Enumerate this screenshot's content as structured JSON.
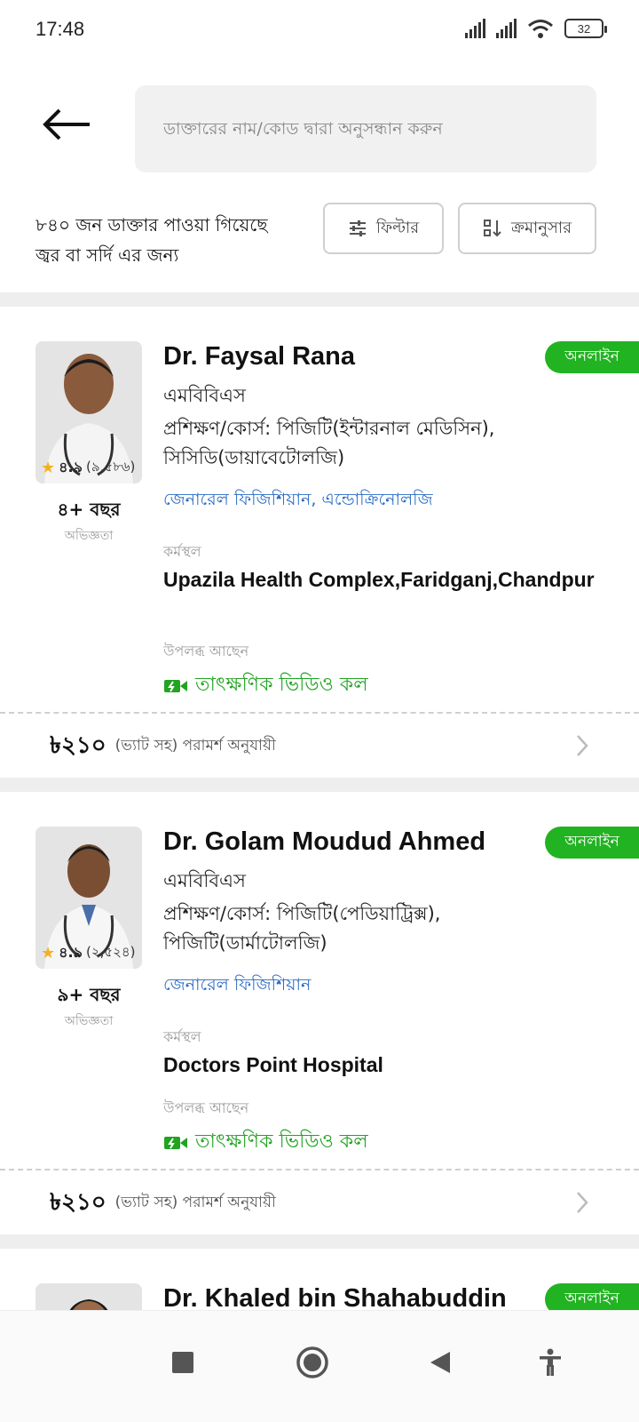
{
  "status": {
    "time": "17:48",
    "battery": "32"
  },
  "search": {
    "placeholder": "ডাক্তারের নাম/কোড দ্বারা অনুসন্ধান করুন"
  },
  "results": {
    "line1": "৮৪০ জন ডাক্তার পাওয়া গিয়েছে",
    "line2": "জ্বর বা সর্দি এর জন্য"
  },
  "toolbar": {
    "filter_label": "ফিল্টার",
    "sort_label": "ক্রমানুসার"
  },
  "doctors": [
    {
      "name": "Dr. Faysal Rana",
      "status": "অনলাইন",
      "degree": "এমবিবিএস",
      "training": "প্রশিক্ষণ/কোর্স: পিজিটি(ইন্টারনাল মেডিসিন), সিসিডি(ডায়াবেটোলজি)",
      "specialty": "জেনারেল ফিজিশিয়ান,  এন্ডোক্রিনোলজি",
      "workplace_label": "কর্মস্থল",
      "workplace": "Upazila Health Complex,Faridganj,Chandpur",
      "availability_label": "উপলব্ধ আছেন",
      "availability": "তাৎক্ষণিক ভিডিও কল",
      "rating": "৪.৯",
      "rating_count": "(৯,৫৮৬)",
      "experience": "৪+ বছর",
      "experience_label": "অভিজ্ঞতা",
      "fee": "৳২১০",
      "fee_note": "(ভ্যাট সহ) পরামর্শ অনুযায়ী"
    },
    {
      "name": "Dr. Golam Moudud Ahmed",
      "status": "অনলাইন",
      "degree": "এমবিবিএস",
      "training": "প্রশিক্ষণ/কোর্স: পিজিটি(পেডিয়াট্রিক্স), পিজিটি(ডার্মাটোলজি)",
      "specialty": "জেনারেল ফিজিশিয়ান",
      "workplace_label": "কর্মস্থল",
      "workplace": "Doctors Point Hospital",
      "availability_label": "উপলব্ধ আছেন",
      "availability": "তাৎক্ষণিক ভিডিও কল",
      "rating": "৪.৯",
      "rating_count": "(২,৫২৪)",
      "experience": "৯+ বছর",
      "experience_label": "অভিজ্ঞতা",
      "fee": "৳২১০",
      "fee_note": "(ভ্যাট সহ) পরামর্শ অনুযায়ী"
    },
    {
      "name": "Dr. Khaled bin Shahabuddin",
      "status": "অনলাইন"
    }
  ],
  "colors": {
    "accent_green": "#22b322",
    "link_blue": "#2b6cc4",
    "star": "#f5b021"
  }
}
